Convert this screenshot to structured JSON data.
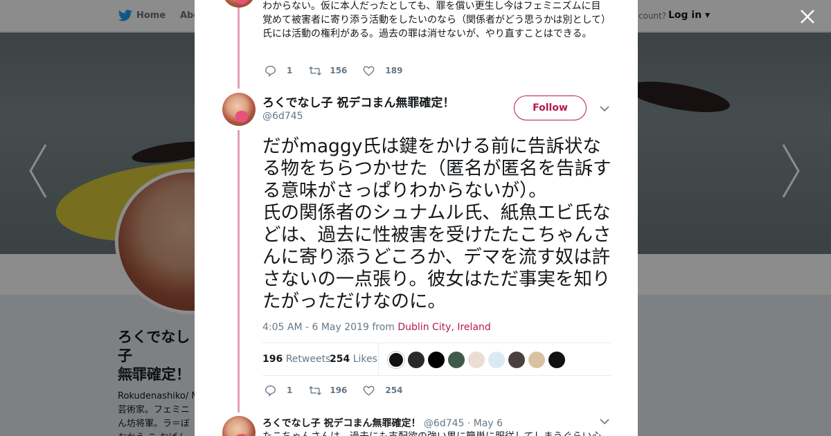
{
  "nav": {
    "home": "Home",
    "about": "Abo",
    "account_prompt": "count?",
    "login": "Log in"
  },
  "profile": {
    "name": "ろくでなし子\n無罪確定！",
    "handle": "@6d745",
    "bio": "Rokudenashiko/ M\n芸術家。フェミニ\nん坊将軍。ラ＝ぼ\nおかえ こ おばん"
  },
  "prev_tweet": {
    "text": "わからない。仮に本人だったとしても、罪を償い更生し今はフェミニズムに目覚めて被害者に寄り添う活動をしたいのなら（関係者がどう思うかは別として）氏には活動の権利がある。過去の罪は消せないが、やり直すことはできる。",
    "replies": "1",
    "retweets": "156",
    "likes": "189"
  },
  "main_tweet": {
    "display_name": "ろくでなし子 祝デコまん無罪確定！",
    "handle": "@6d745",
    "follow_label": "Follow",
    "text": "だがmaggy氏は鍵をかける前に告訴状なる物をちらつかせた（匿名が匿名を告訴する意味がさっぱりわからないが）。\n氏の関係者のシュナムル氏、紙魚エビ氏などは、過去に性被害を受けたたこちゃんさんに寄り添うどころか、デマを流す奴は許さないの一点張り。彼女はただ事実を知りたがっただけなのに。",
    "timestamp": "4:05 AM - 6 May 2019 from",
    "location": "Dublin City, Ireland",
    "retweet_count": "196",
    "retweet_label": "Retweets",
    "like_count": "254",
    "like_label": "Likes",
    "liker_avatars": [
      "avatar-1",
      "avatar-2",
      "avatar-3",
      "avatar-4",
      "avatar-5",
      "avatar-6",
      "avatar-7",
      "avatar-8",
      "avatar-9"
    ],
    "replies": "1",
    "retweets": "196",
    "likes": "254"
  },
  "reply_tweet": {
    "display_name": "ろくでなし子 祝デコまん無罪確定！",
    "handle_date": "@6d745 · May 6",
    "text": "たこちゃんさんは、過去にも支配欲の強い男に簡単に服従してしまうぐらい心"
  },
  "colors": {
    "accent": "#b5194b",
    "thread": "#e2a1b5",
    "muted": "#657786"
  }
}
